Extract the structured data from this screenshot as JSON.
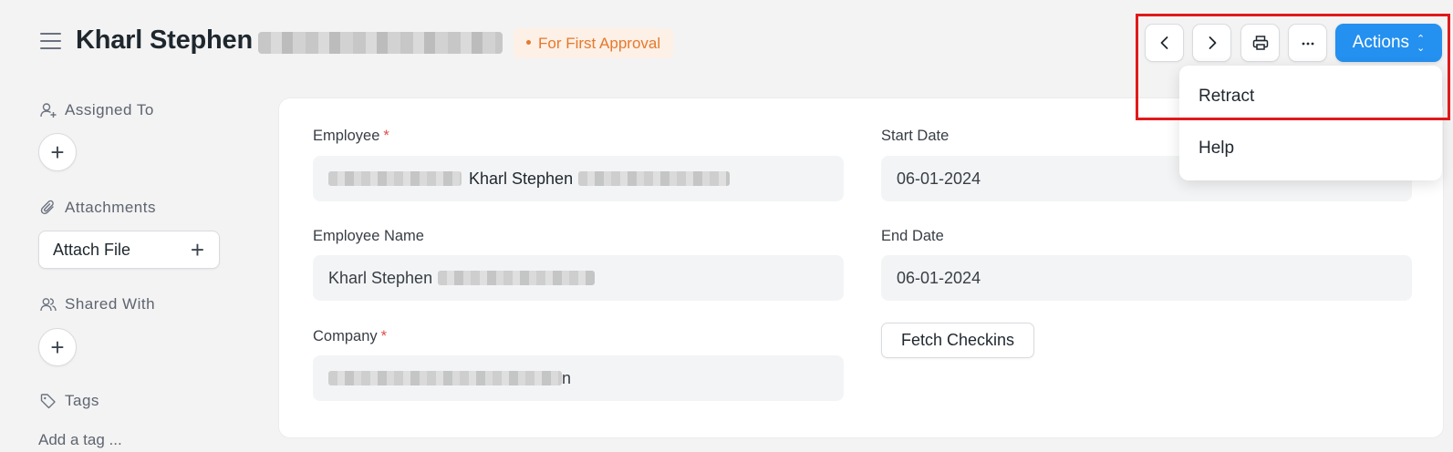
{
  "header": {
    "title": "Kharl Stephen",
    "status": "For First Approval",
    "actions_label": "Actions"
  },
  "actions_menu": {
    "items": [
      "Retract",
      "Help"
    ]
  },
  "sidebar": {
    "assigned_to": "Assigned To",
    "attachments": "Attachments",
    "attach_file": "Attach File",
    "shared_with": "Shared With",
    "tags": "Tags",
    "add_tag": "Add a tag ..."
  },
  "form": {
    "employee": {
      "label": "Employee",
      "value": "Kharl Stephen"
    },
    "employee_name": {
      "label": "Employee Name",
      "value": "Kharl Stephen"
    },
    "company": {
      "label": "Company",
      "value": "n"
    },
    "start_date": {
      "label": "Start Date",
      "value": "06-01-2024"
    },
    "end_date": {
      "label": "End Date",
      "value": "06-01-2024"
    },
    "fetch_checkins": "Fetch Checkins"
  },
  "colors": {
    "primary": "#2490ef",
    "status": "#e5792d",
    "highlight": "#e0191b"
  }
}
